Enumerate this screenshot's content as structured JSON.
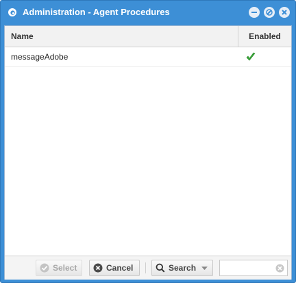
{
  "window": {
    "title": "Administration - Agent Procedures",
    "accent_color": "#3d8fd6",
    "controls": [
      "minimize-icon",
      "restore-icon",
      "close-icon"
    ]
  },
  "grid": {
    "columns": [
      "Name",
      "Enabled"
    ],
    "rows": [
      {
        "name": "messageAdobe",
        "enabled": true,
        "enabled_icon": "checkmark-icon"
      }
    ]
  },
  "toolbar": {
    "select_label": "Select",
    "select_disabled": true,
    "cancel_label": "Cancel",
    "search_label": "Search",
    "search_value": ""
  }
}
